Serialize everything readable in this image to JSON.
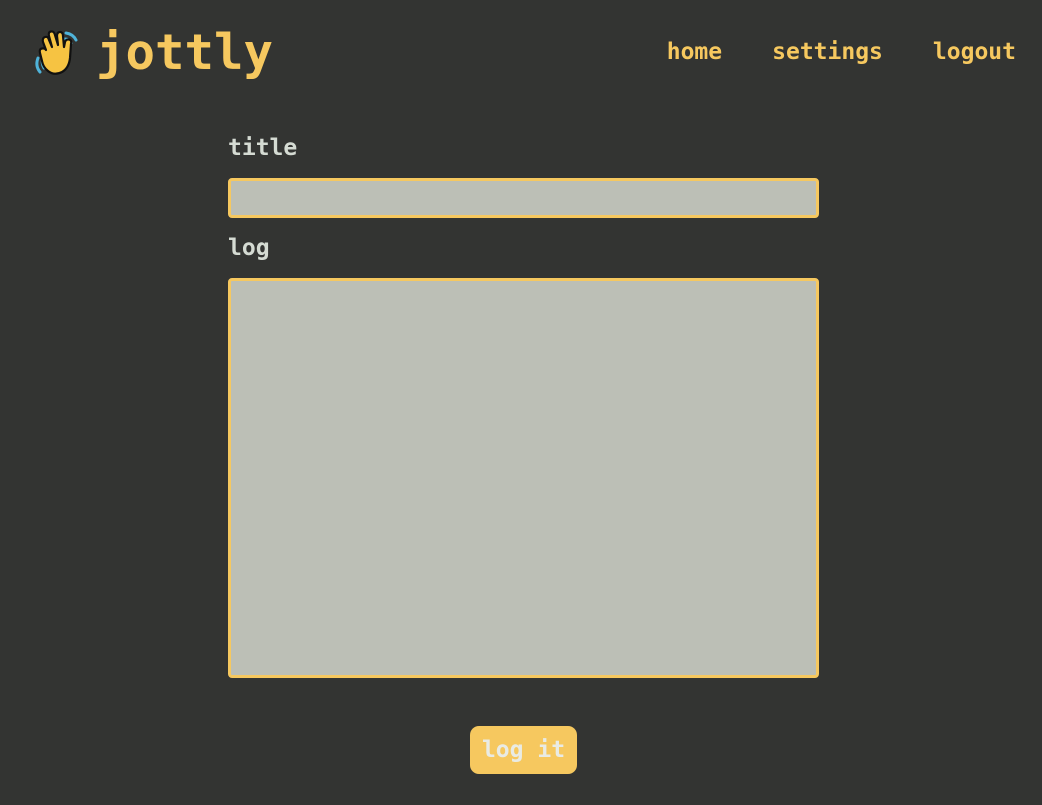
{
  "header": {
    "logo_icon": "waving-hand-icon",
    "brand": "jottly",
    "nav": {
      "home": "home",
      "settings": "settings",
      "logout": "logout"
    }
  },
  "form": {
    "title_label": "title",
    "title_value": "",
    "log_label": "log",
    "log_value": "",
    "submit_label": "log it"
  },
  "colors": {
    "background": "#333432",
    "accent": "#f6c85f",
    "label_text": "#d5dbd3",
    "input_background": "#bcbfb6",
    "button_text": "#e9ebe4"
  }
}
